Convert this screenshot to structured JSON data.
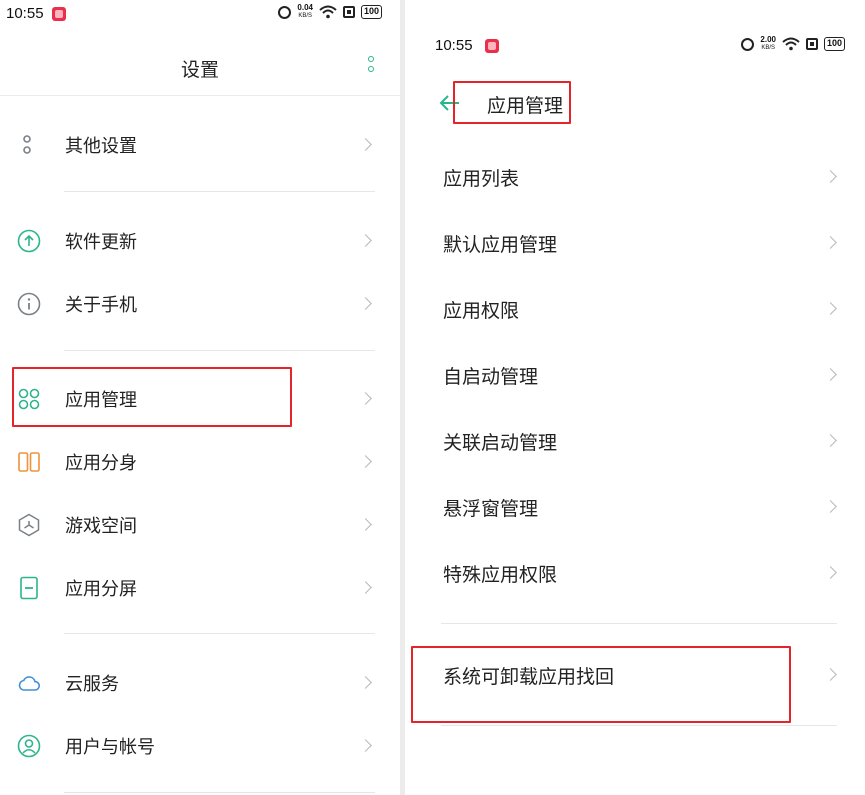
{
  "left": {
    "status": {
      "time": "10:55",
      "speed_value": "0.04",
      "speed_unit": "KB/S",
      "battery": "100"
    },
    "title": "设置",
    "items": [
      {
        "label": "其他设置",
        "icon": "settings-dots-icon"
      },
      {
        "label": "软件更新",
        "icon": "update-arrow-icon"
      },
      {
        "label": "关于手机",
        "icon": "info-icon"
      },
      {
        "label": "应用管理",
        "icon": "app-management-icon"
      },
      {
        "label": "应用分身",
        "icon": "app-clone-icon"
      },
      {
        "label": "游戏空间",
        "icon": "game-space-icon"
      },
      {
        "label": "应用分屏",
        "icon": "split-screen-icon"
      },
      {
        "label": "云服务",
        "icon": "cloud-icon"
      },
      {
        "label": "用户与帐号",
        "icon": "user-account-icon"
      }
    ]
  },
  "right": {
    "status": {
      "time": "10:55",
      "speed_value": "2.00",
      "speed_unit": "KB/S",
      "battery": "100"
    },
    "title": "应用管理",
    "items": [
      {
        "label": "应用列表"
      },
      {
        "label": "默认应用管理"
      },
      {
        "label": "应用权限"
      },
      {
        "label": "自启动管理"
      },
      {
        "label": "关联启动管理"
      },
      {
        "label": "悬浮窗管理"
      },
      {
        "label": "特殊应用权限"
      },
      {
        "label": "系统可卸载应用找回"
      }
    ]
  },
  "colors": {
    "accent": "#2bb58a",
    "highlight": "#e3242b",
    "chevron": "#b8b8b8"
  }
}
